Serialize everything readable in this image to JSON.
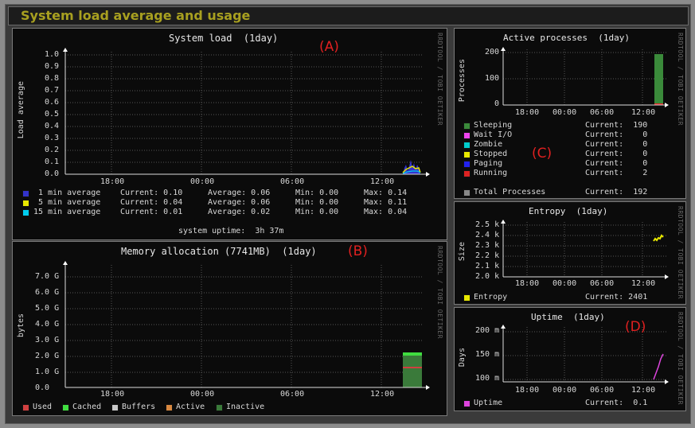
{
  "page": {
    "title": "System load average and usage"
  },
  "annotations": {
    "a": "(A)",
    "b": "(B)",
    "c": "(C)",
    "d": "(D)"
  },
  "side_label": "RRDTOOL / TOBI OETIKER",
  "x_ticks": [
    "18:00",
    "00:00",
    "06:00",
    "12:00"
  ],
  "load": {
    "title": "System load  (1day)",
    "ylabel": "Load average",
    "y_ticks": [
      "1.0",
      "0.9",
      "0.8",
      "0.7",
      "0.6",
      "0.5",
      "0.4",
      "0.3",
      "0.2",
      "0.1",
      "0.0"
    ],
    "legend": [
      {
        "name": "1 min average",
        "current": "Current: 0.10",
        "average": "Average: 0.06",
        "min": "Min: 0.00",
        "max": "Max: 0.14",
        "color": "#3333cc"
      },
      {
        "name": "5 min average",
        "current": "Current: 0.04",
        "average": "Average: 0.06",
        "min": "Min: 0.00",
        "max": "Max: 0.11",
        "color": "#e8e800"
      },
      {
        "name": "15 min average",
        "current": "Current: 0.01",
        "average": "Average: 0.02",
        "min": "Min: 0.00",
        "max": "Max: 0.04",
        "color": "#00ccee"
      }
    ],
    "uptime": "system uptime:  3h 37m"
  },
  "memory": {
    "title": "Memory allocation (7741MB)  (1day)",
    "ylabel": "bytes",
    "y_ticks": [
      "7.0 G",
      "6.0 G",
      "5.0 G",
      "4.0 G",
      "3.0 G",
      "2.0 G",
      "1.0 G",
      "0.0"
    ],
    "legend": [
      {
        "name": "Used",
        "color": "#d04040"
      },
      {
        "name": "Cached",
        "color": "#40dd40"
      },
      {
        "name": "Buffers",
        "color": "#c8c8c8"
      },
      {
        "name": "Active",
        "color": "#d88840"
      },
      {
        "name": "Inactive",
        "color": "#3a7a3a"
      }
    ]
  },
  "processes": {
    "title": "Active processes  (1day)",
    "ylabel": "Processes",
    "y_ticks": [
      "200",
      "100",
      "0"
    ],
    "legend": [
      {
        "name": "Sleeping",
        "current": "Current:  190",
        "color": "#3a8a3a"
      },
      {
        "name": "Wait I/O",
        "current": "Current:    0",
        "color": "#ee44ee"
      },
      {
        "name": "Zombie",
        "current": "Current:    0",
        "color": "#00cccc"
      },
      {
        "name": "Stopped",
        "current": "Current:    0",
        "color": "#e8e800"
      },
      {
        "name": "Paging",
        "current": "Current:    0",
        "color": "#2222ee"
      },
      {
        "name": "Running",
        "current": "Current:    2",
        "color": "#dd2222"
      }
    ],
    "total": {
      "name": "Total Processes",
      "current": "Current:  192",
      "color": "#888888"
    }
  },
  "entropy": {
    "title": "Entropy  (1day)",
    "ylabel": "Size",
    "y_ticks": [
      "2.5 k",
      "2.4 k",
      "2.3 k",
      "2.2 k",
      "2.1 k",
      "2.0 k"
    ],
    "legend": {
      "name": "Entropy",
      "current": "Current: 2401",
      "color": "#e8e800"
    }
  },
  "uptime": {
    "title": "Uptime  (1day)",
    "ylabel": "Days",
    "y_ticks": [
      "200 m",
      "150 m",
      "100 m"
    ],
    "legend": {
      "name": "Uptime",
      "current": "Current:  0.1",
      "color": "#dd44dd"
    }
  }
}
